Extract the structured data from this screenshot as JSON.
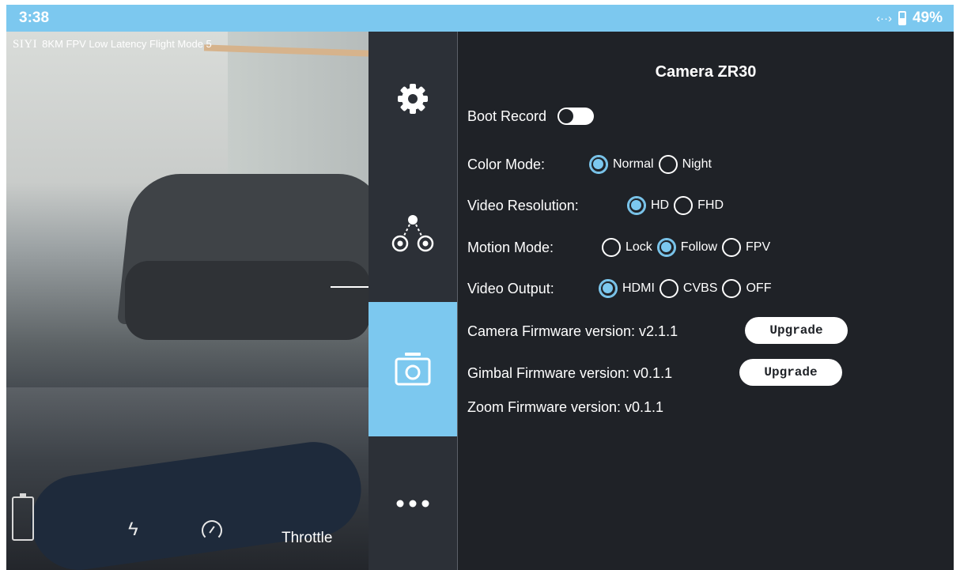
{
  "status_bar": {
    "time": "3:38",
    "battery_percent": "49%",
    "battery_level": 0.49,
    "link_icon": "link-arrows-icon",
    "color": "#7cc8ef"
  },
  "video_feed": {
    "brand": "SIYI",
    "title": "8KM FPV Low Latency Flight Mode 5",
    "hud": {
      "battery_icon": "battery-icon",
      "power_icon": "lightning-icon",
      "speed_icon": "speedometer-icon",
      "throttle_label": "Throttle"
    }
  },
  "side_nav": {
    "items": [
      {
        "icon": "gear-icon",
        "active": false
      },
      {
        "icon": "gimbal-icon",
        "active": false
      },
      {
        "icon": "camera-icon",
        "active": true
      },
      {
        "icon": "more-icon",
        "active": false
      }
    ],
    "active_color": "#7cc8ef"
  },
  "panel": {
    "title": "Camera ZR30",
    "boot_record": {
      "label": "Boot Record",
      "enabled": false
    },
    "color_mode": {
      "label": "Color Mode:",
      "options": [
        "Normal",
        "Night"
      ],
      "selected": "Normal"
    },
    "video_resolution": {
      "label": "Video Resolution:",
      "options": [
        "HD",
        "FHD"
      ],
      "selected": "HD"
    },
    "motion_mode": {
      "label": "Motion Mode:",
      "options": [
        "Lock",
        "Follow",
        "FPV"
      ],
      "selected": "Follow"
    },
    "video_output": {
      "label": "Video Output:",
      "options": [
        "HDMI",
        "CVBS",
        "OFF"
      ],
      "selected": "HDMI"
    },
    "camera_firmware": {
      "label": "Camera Firmware version: v2.1.1",
      "button": "Upgrade"
    },
    "gimbal_firmware": {
      "label": "Gimbal Firmware version: v0.1.1",
      "button": "Upgrade"
    },
    "zoom_firmware": {
      "label": "Zoom Firmware version: v0.1.1"
    }
  }
}
